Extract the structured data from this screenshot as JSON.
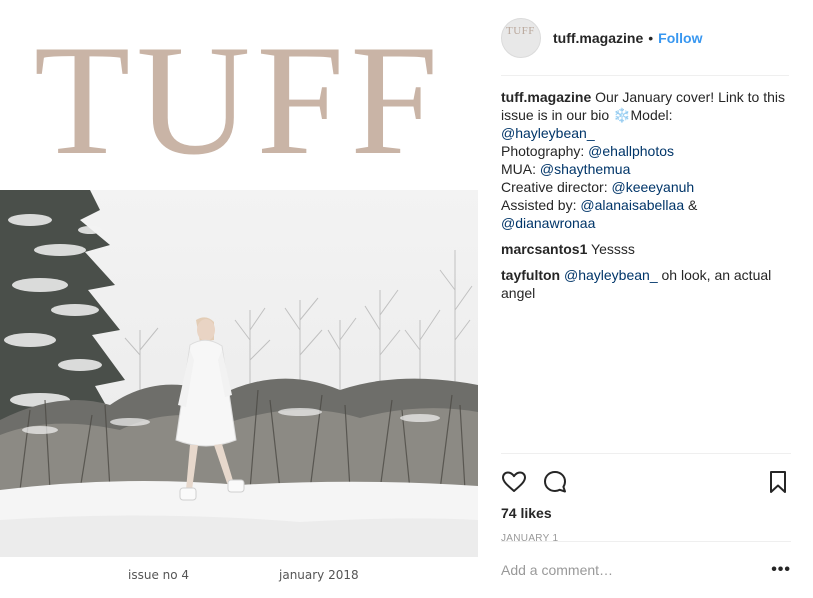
{
  "cover": {
    "title": "TUFF",
    "issue_no": "issue no 4",
    "issue_date": "january 2018"
  },
  "header": {
    "avatar_text": "TUFF",
    "username": "tuff.magazine",
    "separator": "•",
    "follow_label": "Follow"
  },
  "caption": {
    "user": "tuff.magazine",
    "text_1": "Our January cover! Link to this issue is in our bio ",
    "emoji": "❄️",
    "text_2": "Model: ",
    "model": "@hayleybean_",
    "photography_label": "Photography: ",
    "photography": "@ehallphotos",
    "mua_label": "MUA: ",
    "mua": "@shaythemua",
    "director_label": "Creative director: ",
    "director": "@keeeyanuh",
    "assisted_label": "Assisted by: ",
    "assisted_1": "@alanaisabellaa",
    "assisted_sep": " & ",
    "assisted_2": "@dianawronaa"
  },
  "comments": [
    {
      "user": "marcsantos1",
      "text": "Yessss"
    },
    {
      "user": "tayfulton",
      "mention": "@hayleybean_",
      "text": " oh look, an actual angel"
    }
  ],
  "actions": {
    "like_icon": "heart-icon",
    "comment_icon": "comment-bubble-icon",
    "save_icon": "bookmark-icon",
    "likes": "74 likes",
    "date": "JANUARY 1"
  },
  "add_comment": {
    "placeholder": "Add a comment…",
    "more_label": "•••"
  },
  "colors": {
    "title": "#c9b4a6",
    "link": "#003569",
    "follow": "#3897f0"
  }
}
